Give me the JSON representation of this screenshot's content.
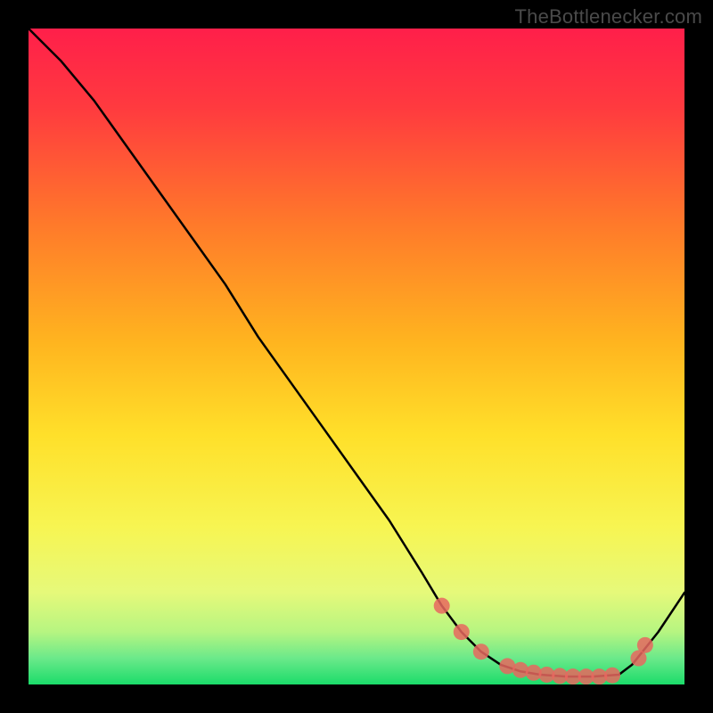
{
  "watermark": "TheBottlenecker.com",
  "colors": {
    "bg": "#000000",
    "curve": "#000000",
    "marker": "#e8675f",
    "gradient_top": "#ff1f4a",
    "gradient_mid": "#ffd92a",
    "gradient_low": "#d5f56a",
    "gradient_green": "#1bdc6a"
  },
  "chart_data": {
    "type": "line",
    "title": "",
    "xlabel": "",
    "ylabel": "",
    "xlim": [
      0,
      100
    ],
    "ylim": [
      0,
      100
    ],
    "curve": {
      "x": [
        0,
        5,
        10,
        15,
        20,
        25,
        30,
        35,
        40,
        45,
        50,
        55,
        60,
        63,
        66,
        69,
        72,
        75,
        78,
        82,
        86,
        90,
        92,
        96,
        100
      ],
      "y": [
        100,
        95,
        89,
        82,
        75,
        68,
        61,
        53,
        46,
        39,
        32,
        25,
        17,
        12,
        8,
        5,
        3,
        2,
        1.5,
        1.2,
        1.2,
        1.5,
        3,
        8,
        14
      ]
    },
    "markers": {
      "x": [
        63,
        66,
        69,
        73,
        75,
        77,
        79,
        81,
        83,
        85,
        87,
        89,
        93,
        94
      ],
      "y": [
        12,
        8,
        5,
        2.8,
        2.2,
        1.8,
        1.5,
        1.3,
        1.2,
        1.2,
        1.2,
        1.4,
        4,
        6
      ]
    }
  }
}
